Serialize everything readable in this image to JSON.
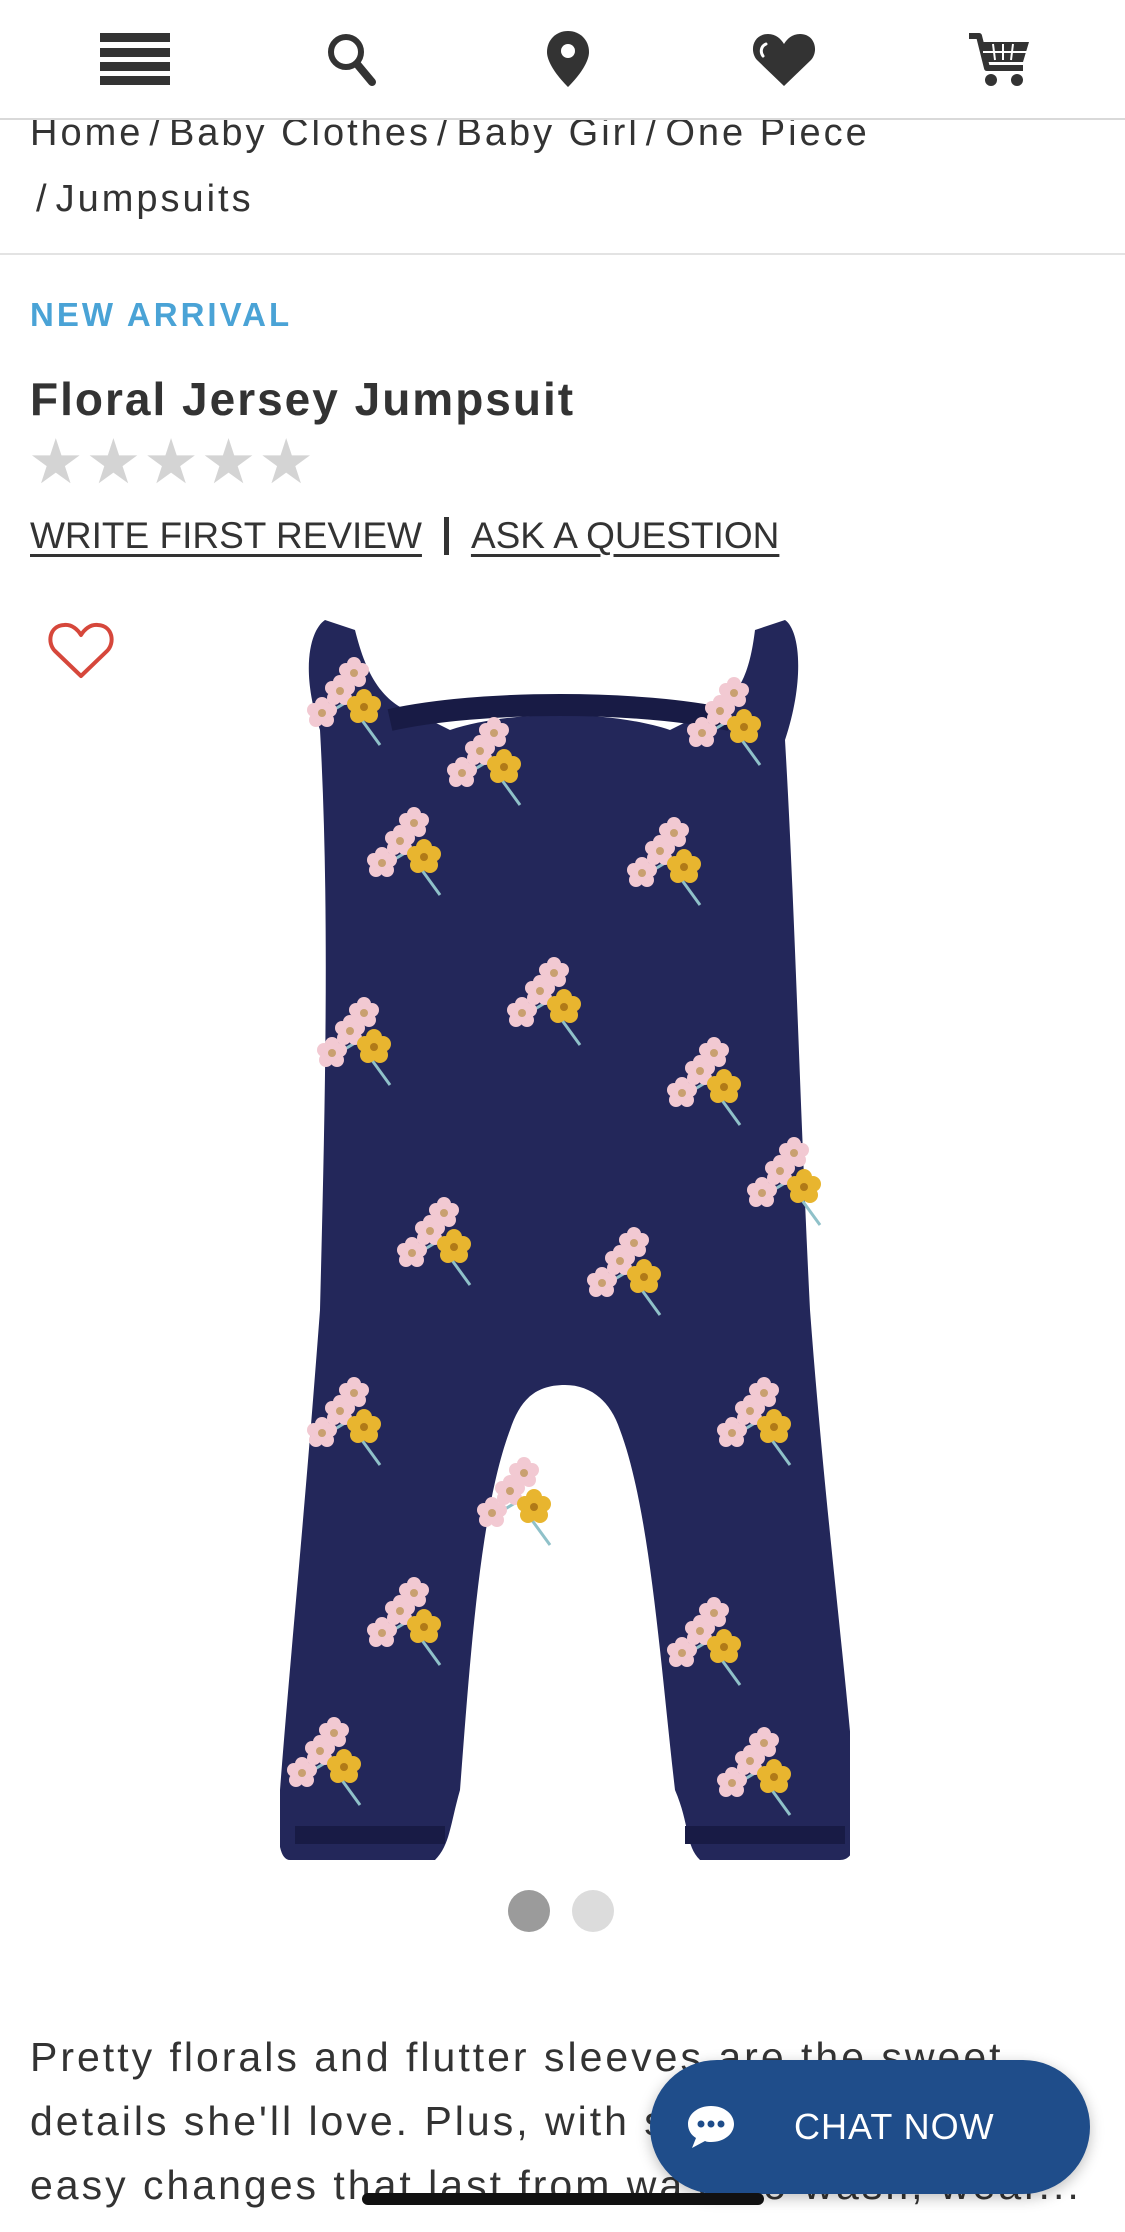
{
  "nav": {
    "icons": [
      "menu-icon",
      "search-icon",
      "location-pin-icon",
      "heart-icon",
      "cart-icon"
    ]
  },
  "breadcrumb": {
    "items": [
      "Home",
      "Baby Clothes",
      "Baby Girl",
      "One Piece",
      "Jumpsuits"
    ],
    "separator": "/"
  },
  "product": {
    "badge": "NEW ARRIVAL",
    "title": "Floral Jersey Jumpsuit",
    "rating": 0,
    "rating_max": 5,
    "write_review_label": "WRITE FIRST REVIEW",
    "ask_question_label": "ASK A QUESTION",
    "image_count": 2,
    "active_image_index": 0,
    "description": "Pretty florals and flutter sleeves are the sweet details she'll love. Plus, with snaps, you'll get easy changes that last from wash to wash, wear..."
  },
  "chat": {
    "label": "CHAT NOW"
  },
  "colors": {
    "badge": "#4aa3d6",
    "chat_button": "#1f4d8a",
    "favorite_heart": "#d6473b",
    "garment": "#23275a"
  }
}
